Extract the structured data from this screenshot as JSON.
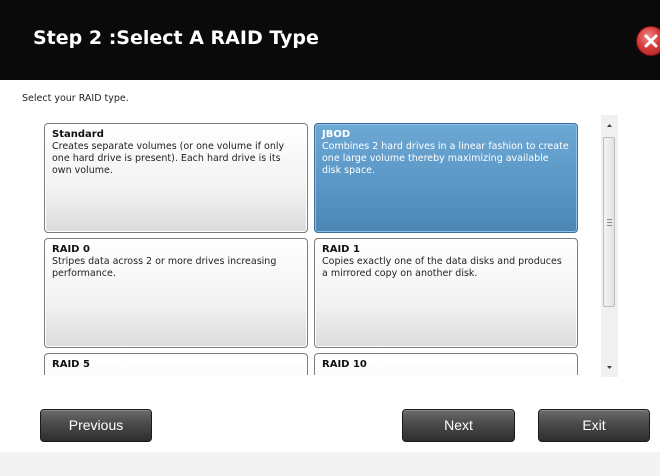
{
  "dialog": {
    "title": "Step 2 :Select A RAID Type",
    "prompt": "Select your RAID type."
  },
  "raid_options": [
    {
      "name": "Standard",
      "description": "Creates separate volumes (or one volume if only one hard drive is present). Each hard drive is its own volume.",
      "selected": false
    },
    {
      "name": "JBOD",
      "description": "Combines 2 hard drives in a linear fashion to create one large volume thereby maximizing available disk space.",
      "selected": true
    },
    {
      "name": "RAID 0",
      "description": "Stripes data across 2 or more drives increasing performance.",
      "selected": false
    },
    {
      "name": "RAID 1",
      "description": "Copies exactly one of the data disks and produces a mirrored copy on another disk.",
      "selected": false
    },
    {
      "name": "RAID 5",
      "description": "",
      "selected": false
    },
    {
      "name": "RAID 10",
      "description": "",
      "selected": false
    }
  ],
  "buttons": {
    "previous": "Previous",
    "next": "Next",
    "exit": "Exit"
  },
  "icons": {
    "close": "close-icon",
    "scroll_up": "arrow-up-icon",
    "scroll_down": "arrow-down-icon"
  },
  "colors": {
    "header_bg": "#0a0a0a",
    "selected_card": "#5a97c6",
    "close_button": "#d63a3a",
    "button_bg": "#4a4a4a"
  }
}
